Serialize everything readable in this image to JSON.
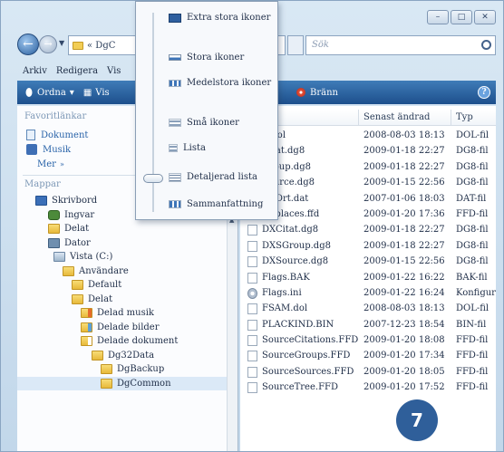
{
  "window": {
    "buttons": [
      "–",
      "□",
      "✕"
    ]
  },
  "address": {
    "path": "« DgC",
    "search_placeholder": "Sök"
  },
  "menubar": [
    "Arkiv",
    "Redigera",
    "Vis"
  ],
  "toolbar": {
    "organize_label": "Ordna",
    "views_label": "Vis",
    "burn_label": "Bränn"
  },
  "view_menu": {
    "options": [
      {
        "label": "Extra stora ikoner"
      },
      {
        "label": "Stora ikoner"
      },
      {
        "label": "Medelstora ikoner"
      },
      {
        "label": "Små ikoner"
      },
      {
        "label": "Lista"
      },
      {
        "label": "Detaljerad lista"
      },
      {
        "label": "Sammanfattning"
      }
    ],
    "selected_label": "Detaljerad lista"
  },
  "nav": {
    "favorites_heading": "Favoritlänkar",
    "favorites": [
      {
        "label": "Dokument",
        "icon": "document-icon"
      },
      {
        "label": "Musik",
        "icon": "music-icon"
      }
    ],
    "more_label": "Mer",
    "folders_heading": "Mappar",
    "tree": [
      {
        "label": "Skrivbord",
        "icon": "desktop-icon",
        "indent": 0
      },
      {
        "label": "Ingvar",
        "icon": "user-icon",
        "indent": 1
      },
      {
        "label": "Delat",
        "icon": "folder-icon",
        "indent": 1
      },
      {
        "label": "Dator",
        "icon": "computer-icon",
        "indent": 1
      },
      {
        "label": "Vista (C:)",
        "icon": "drive-icon",
        "indent": 2
      },
      {
        "label": "Användare",
        "icon": "folder-icon",
        "indent": 3
      },
      {
        "label": "Default",
        "icon": "folder-icon",
        "indent": 4
      },
      {
        "label": "Delat",
        "icon": "folder-icon",
        "indent": 4
      },
      {
        "label": "Delad musik",
        "icon": "music-folder-icon",
        "indent": 5
      },
      {
        "label": "Delade bilder",
        "icon": "picture-folder-icon",
        "indent": 5
      },
      {
        "label": "Delade dokument",
        "icon": "document-folder-icon",
        "indent": 5
      },
      {
        "label": "Dg32Data",
        "icon": "folder-icon",
        "indent": 6
      },
      {
        "label": "DgBackup",
        "icon": "folder-icon",
        "indent": 7
      },
      {
        "label": "DgCommon",
        "icon": "folder-icon",
        "indent": 7
      }
    ]
  },
  "files": {
    "columns": {
      "name": "",
      "date": "Senast ändrad",
      "type": "Typ"
    },
    "rows": [
      {
        "name": "A.dol",
        "date": "2008-08-03 18:13",
        "type": "DOL-fil",
        "icon": "file-icon"
      },
      {
        "name": "Citat.dg8",
        "date": "2009-01-18 22:27",
        "type": "DG8-fil",
        "icon": "file-icon"
      },
      {
        "name": "Group.dg8",
        "date": "2009-01-18 22:27",
        "type": "DG8-fil",
        "icon": "file-icon"
      },
      {
        "name": "Source.dg8",
        "date": "2009-01-15 22:56",
        "type": "DG8-fil",
        "icon": "file-icon"
      },
      {
        "name": "artOrt.dat",
        "date": "2007-01-06 18:03",
        "type": "DAT-fil",
        "icon": "file-icon"
      },
      {
        "name": "Dgplaces.ffd",
        "date": "2009-01-20 17:36",
        "type": "FFD-fil",
        "icon": "file-icon"
      },
      {
        "name": "DXCitat.dg8",
        "date": "2009-01-18 22:27",
        "type": "DG8-fil",
        "icon": "file-icon"
      },
      {
        "name": "DXSGroup.dg8",
        "date": "2009-01-18 22:27",
        "type": "DG8-fil",
        "icon": "file-icon"
      },
      {
        "name": "DXSource.dg8",
        "date": "2009-01-15 22:56",
        "type": "DG8-fil",
        "icon": "file-icon"
      },
      {
        "name": "Flags.BAK",
        "date": "2009-01-22 16:22",
        "type": "BAK-fil",
        "icon": "file-icon"
      },
      {
        "name": "Flags.ini",
        "date": "2009-01-22 16:24",
        "type": "Konfigur",
        "icon": "settings-file-icon"
      },
      {
        "name": "FSAM.dol",
        "date": "2008-08-03 18:13",
        "type": "DOL-fil",
        "icon": "file-icon"
      },
      {
        "name": "PLACKIND.BIN",
        "date": "2007-12-23 18:54",
        "type": "BIN-fil",
        "icon": "file-icon"
      },
      {
        "name": "SourceCitations.FFD",
        "date": "2009-01-20 18:08",
        "type": "FFD-fil",
        "icon": "file-icon"
      },
      {
        "name": "SourceGroups.FFD",
        "date": "2009-01-20 17:34",
        "type": "FFD-fil",
        "icon": "file-icon"
      },
      {
        "name": "SourceSources.FFD",
        "date": "2009-01-20 18:05",
        "type": "FFD-fil",
        "icon": "file-icon"
      },
      {
        "name": "SourceTree.FFD",
        "date": "2009-01-20 17:52",
        "type": "FFD-fil",
        "icon": "file-icon"
      }
    ]
  },
  "callout": {
    "number": "7"
  },
  "colors": {
    "toolbar": "#1d4f8c",
    "badge": "#2f5f9a",
    "link": "#2862a8"
  }
}
